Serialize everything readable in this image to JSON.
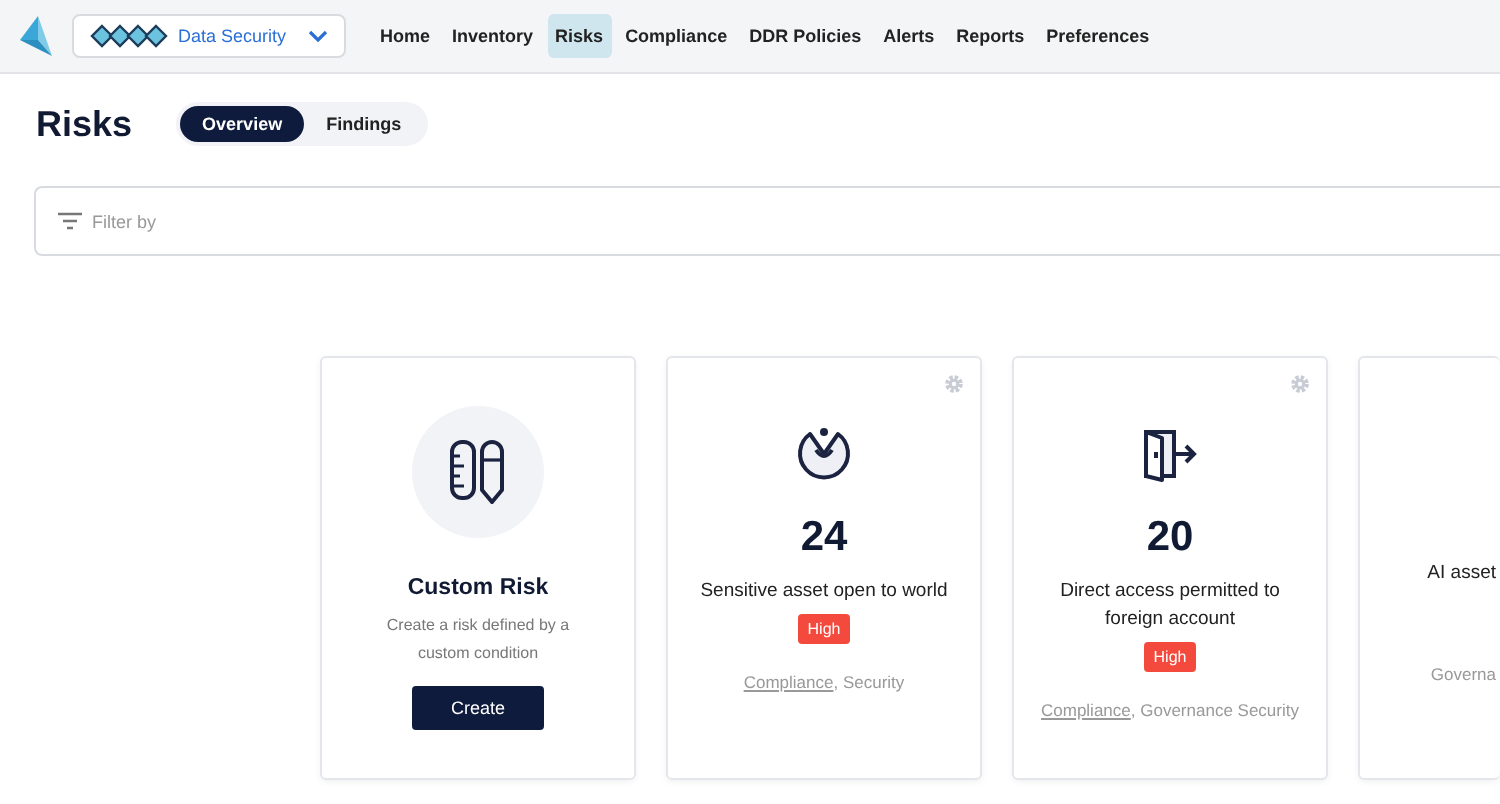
{
  "nav": {
    "product": "Data Security",
    "items": [
      {
        "label": "Home",
        "selected": false
      },
      {
        "label": "Inventory",
        "selected": false
      },
      {
        "label": "Risks",
        "selected": true
      },
      {
        "label": "Compliance",
        "selected": false
      },
      {
        "label": "DDR Policies",
        "selected": false
      },
      {
        "label": "Alerts",
        "selected": false
      },
      {
        "label": "Reports",
        "selected": false
      },
      {
        "label": "Preferences",
        "selected": false
      }
    ]
  },
  "page": {
    "title": "Risks",
    "views": [
      {
        "label": "Overview",
        "selected": true
      },
      {
        "label": "Findings",
        "selected": false
      }
    ]
  },
  "filter": {
    "placeholder": "Filter by"
  },
  "cards": [
    {
      "kind": "custom",
      "title": "Custom Risk",
      "description": "Create a risk defined by a custom condition",
      "button": "Create"
    },
    {
      "kind": "risk",
      "count": "24",
      "title": "Sensitive asset open to world",
      "severity": "High",
      "tags": [
        {
          "text": "Compliance",
          "link": true
        },
        {
          "text": ", Security",
          "link": false
        }
      ]
    },
    {
      "kind": "risk",
      "count": "20",
      "title": "Direct access permitted to foreign account",
      "severity": "High",
      "tags": [
        {
          "text": "Compliance",
          "link": true
        },
        {
          "text": ", Governance Security",
          "link": false
        }
      ]
    },
    {
      "kind": "partial",
      "title": "AI asset",
      "tags": [
        {
          "text": "Governa",
          "link": false
        }
      ]
    }
  ]
}
